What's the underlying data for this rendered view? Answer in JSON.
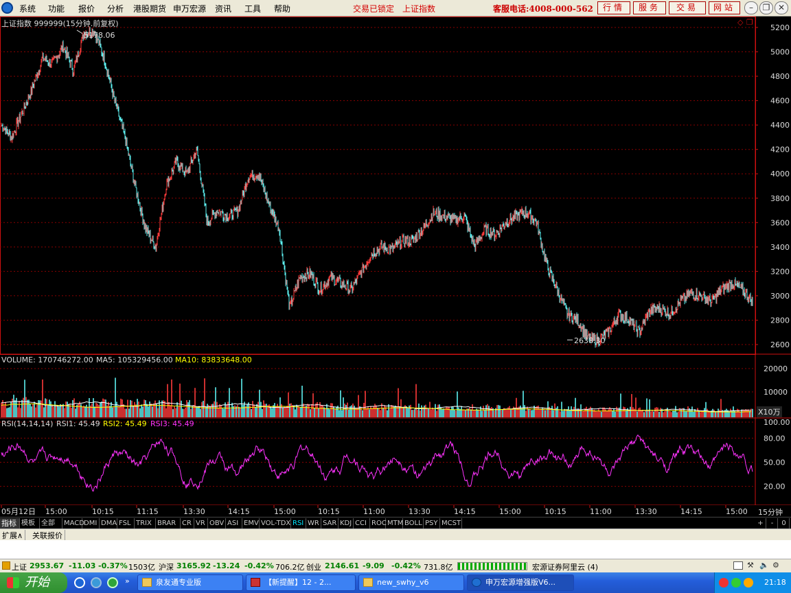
{
  "menu": {
    "items": [
      "系统",
      "功能",
      "报价",
      "分析",
      "港股期货",
      "申万宏源",
      "资讯",
      "工具",
      "帮助"
    ],
    "locked_text": "交易已锁定",
    "index_text": "上证指数",
    "hotline": "客服电话:4008-000-562",
    "right_buttons": [
      "行情",
      "服务",
      "交易",
      "网站"
    ]
  },
  "chart": {
    "title": "上证指数 999999(15分钟.前复权)",
    "max_label": "5178.06",
    "min_label": "2638.30",
    "volume_label": "VOLUME: 170746272.00",
    "ma5_label": "MA5: 105329456.00",
    "ma10_label": "MA10: 83833648.00",
    "volume_unit": "X10万",
    "rsi_label": "RSI(14,14,14)",
    "rsi1_label": "RSI1: 45.49",
    "rsi2_label": "RSI2: 45.49",
    "rsi3_label": "RSI3: 45.49",
    "period_label": "15分钟",
    "colors": {
      "up": "#ff3b3b",
      "down": "#5ef2f2",
      "volume_ma5": "#ffffff",
      "volume_ma10": "#ffff00",
      "rsi": "#ff33ff",
      "grid": "#8b0000",
      "axis": "#d01010"
    }
  },
  "chart_data": [
    {
      "type": "line",
      "title": "上证指数 999999(15分钟.前复权)",
      "x": [
        "05月12日",
        "15:00",
        "10:15",
        "11:15",
        "13:30",
        "14:15",
        "15:00",
        "10:15",
        "11:00",
        "13:30",
        "14:15",
        "15:00",
        "10:15",
        "11:00",
        "13:30",
        "14:15",
        "15:00"
      ],
      "ylim": [
        2600,
        5200
      ],
      "yticks": [
        2600,
        2800,
        3000,
        3200,
        3400,
        3600,
        3800,
        4000,
        4200,
        4400,
        4600,
        4800,
        5000,
        5200
      ],
      "series": [
        {
          "name": "上证指数",
          "points": [
            4400,
            4300,
            4500,
            4700,
            4950,
            4900,
            5050,
            4850,
            5150,
            5178,
            4950,
            4600,
            4300,
            3900,
            3550,
            3400,
            3900,
            4100,
            4000,
            4200,
            3600,
            3700,
            3650,
            3700,
            3980,
            4000,
            3750,
            3550,
            2900,
            3150,
            3180,
            3050,
            3150,
            3100,
            3050,
            3200,
            3350,
            3400,
            3380,
            3450,
            3450,
            3550,
            3680,
            3650,
            3620,
            3650,
            3400,
            3550,
            3500,
            3600,
            3650,
            3690,
            3600,
            3250,
            3050,
            2850,
            2800,
            2650,
            2638,
            2700,
            2850,
            2800,
            2700,
            2880,
            2900,
            2850,
            2950,
            3020,
            3000,
            2950,
            3050,
            3100,
            3050,
            2950
          ]
        }
      ]
    },
    {
      "type": "bar",
      "title": "VOLUME",
      "ylim": [
        0,
        25000
      ],
      "yticks": [
        10000,
        20000
      ],
      "series": [
        {
          "name": "VOLUME",
          "values": []
        }
      ]
    },
    {
      "type": "line",
      "title": "RSI(14,14,14)",
      "ylim": [
        0,
        100
      ],
      "yticks": [
        20.0,
        50.0,
        80.0,
        100.0
      ],
      "series": [
        {
          "name": "RSI1",
          "values": [
            45.49
          ]
        }
      ]
    }
  ],
  "xaxis": {
    "labels": [
      "05月12日",
      "15:00",
      "10:15",
      "11:15",
      "13:30",
      "14:15",
      "15:00",
      "10:15",
      "11:00",
      "13:30",
      "14:15",
      "15:00",
      "10:15",
      "11:00",
      "13:30",
      "14:15",
      "15:00"
    ]
  },
  "yaxis": {
    "price": [
      "5200",
      "5000",
      "4800",
      "4600",
      "4400",
      "4200",
      "4000",
      "3800",
      "3600",
      "3400",
      "3200",
      "3000",
      "2800",
      "2600"
    ],
    "volume": [
      "20000",
      "10000"
    ],
    "rsi": [
      "100.00",
      "80.00",
      "50.00",
      "20.00"
    ]
  },
  "tabs": [
    "指标",
    "模板",
    "全部",
    "MACD",
    "DMI",
    "DMA",
    "FSL",
    "TRIX",
    "BRAR",
    "CR",
    "VR",
    "OBV",
    "ASI",
    "EMV",
    "VOL-TDX",
    "RSI",
    "WR",
    "SAR",
    "KDJ",
    "CCI",
    "ROC",
    "MTM",
    "BOLL",
    "PSY",
    "MCST"
  ],
  "tab_right": [
    "+",
    "-",
    "0"
  ],
  "ext_tabs": [
    "扩展∧",
    "关联报价"
  ],
  "status": {
    "sh_name": "上证",
    "sh_price": "2953.67",
    "sh_chg": "-11.03",
    "sh_pct": "-0.37%",
    "sh_amt": "1503亿",
    "hs_name": "沪深",
    "hs_price": "3165.92",
    "hs_chg": "-13.24",
    "hs_pct": "-0.42%",
    "hs_amt": "706.2亿",
    "cy_name": "创业",
    "cy_price": "2146.61",
    "cy_chg": "-9.09",
    "cy_pct": "-0.42%",
    "cy_amt": "731.8亿",
    "server": "宏源证券阿里云 (4)"
  },
  "taskbar": {
    "start": "开始",
    "tasks": [
      "泉友通专业版",
      "【新提醒】12 - 2...",
      "new_swhy_v6",
      "申万宏源增强版V6..."
    ],
    "clock": "21:18"
  }
}
